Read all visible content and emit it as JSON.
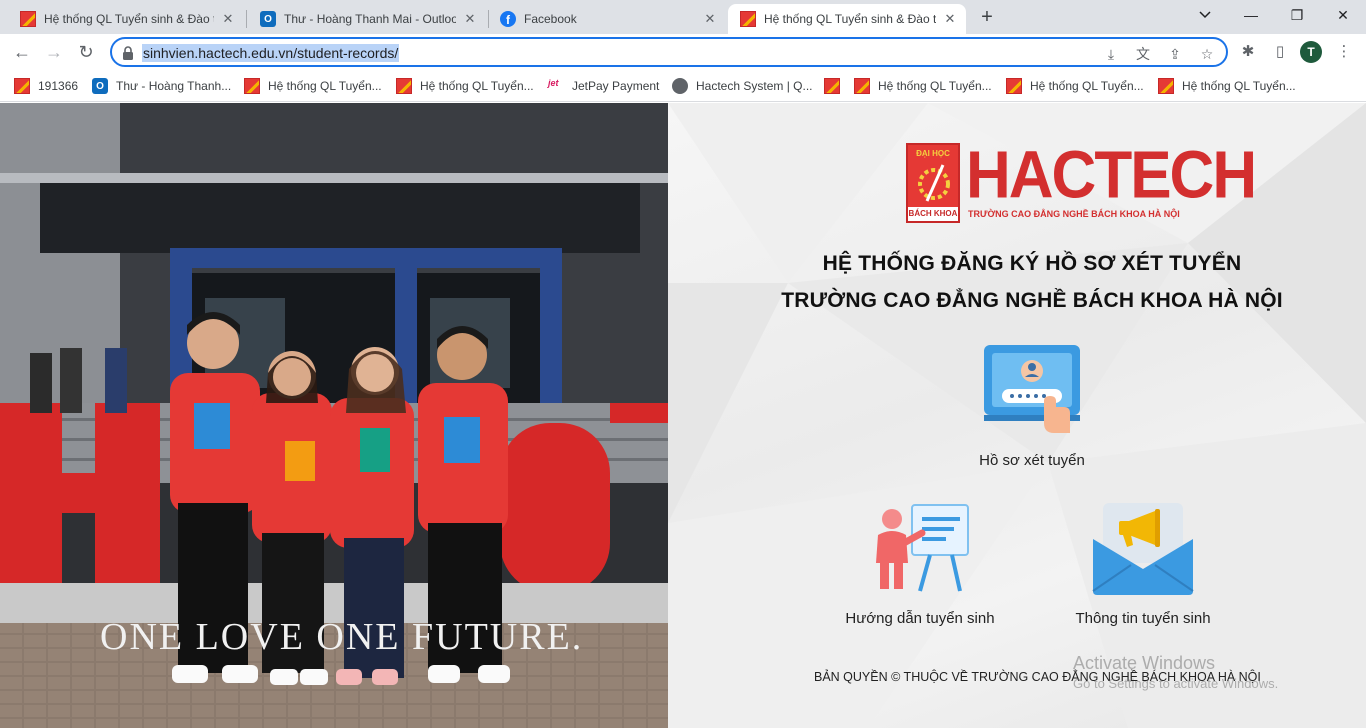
{
  "browser": {
    "tabs": [
      {
        "title": "Hệ thống QL Tuyển sinh & Đào tạo",
        "favicon": "hactech-favicon",
        "active": false
      },
      {
        "title": "Thư - Hoàng Thanh Mai - Outlook",
        "favicon": "outlook-favicon",
        "active": false
      },
      {
        "title": "Facebook",
        "favicon": "facebook-favicon",
        "active": false
      },
      {
        "title": "Hệ thống QL Tuyển sinh & Đào tạo",
        "favicon": "hactech-favicon",
        "active": true
      }
    ],
    "new_tab": "+",
    "window_controls": {
      "minimize": "—",
      "restore": "❐",
      "close": "✕"
    },
    "url": "sinhvien.hactech.edu.vn/student-records/",
    "profile_initial": "T",
    "bookmarks": [
      {
        "label": "191366",
        "favicon": "hactech-favicon"
      },
      {
        "label": "Thư - Hoàng Thanh...",
        "favicon": "outlook-favicon"
      },
      {
        "label": "Hệ thống QL Tuyển...",
        "favicon": "hactech-favicon"
      },
      {
        "label": "Hệ thống QL Tuyển...",
        "favicon": "hactech-favicon"
      },
      {
        "label": "JetPay Payment",
        "favicon": "jetpay-favicon"
      },
      {
        "label": "Hactech System | Q...",
        "favicon": "globe-favicon"
      },
      {
        "label": "",
        "favicon": "hactech-favicon"
      },
      {
        "label": "Hệ thống QL Tuyển...",
        "favicon": "hactech-favicon"
      },
      {
        "label": "Hệ thống QL Tuyển...",
        "favicon": "hactech-favicon"
      },
      {
        "label": "Hệ thống QL Tuyển...",
        "favicon": "hactech-favicon"
      }
    ]
  },
  "page": {
    "photo_slogan": "ONE LOVE ONE FUTURE.",
    "logo": {
      "emblem_top": "ĐẠI HỌC",
      "emblem_bottom": "BÁCH KHOA",
      "wordmark": "HACTECH",
      "subtitle": "TRƯỜNG CAO ĐẲNG NGHỀ BÁCH KHOA HÀ NỘI"
    },
    "heading_line1": "HỆ THỐNG ĐĂNG KÝ HỒ SƠ XÉT TUYỂN",
    "heading_line2": "TRƯỜNG CAO ĐẲNG NGHỀ BÁCH KHOA HÀ NỘI",
    "cards": {
      "records": "Hồ sơ xét tuyển",
      "guide": "Hướng dẫn tuyển sinh",
      "info": "Thông tin tuyển sinh"
    },
    "footer": "BẢN QUYỀN © THUỘC VỀ TRƯỜNG CAO ĐẲNG NGHỀ BÁCH KHOA HÀ NỘI",
    "watermark_line1": "Activate Windows",
    "watermark_line2": "Go to Settings to activate Windows."
  },
  "colors": {
    "brand_red": "#d32f2f",
    "omnibox_focus": "#1a73e8",
    "jacket_red": "#e53935"
  }
}
